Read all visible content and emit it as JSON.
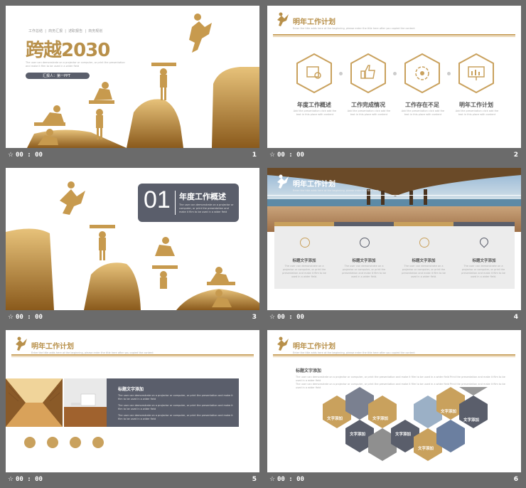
{
  "slides": [
    {
      "number": "1",
      "time": "00 : 00",
      "nav": [
        "工作总结",
        "商务汇报",
        "述职报告",
        "商务规划"
      ],
      "title": "跨越2030",
      "subtitle": "The user can demonstrate on a projector or computer, or print the presentation and make it film to be used in a wider field",
      "presenter": "汇报人：第一PPT"
    },
    {
      "number": "2",
      "time": "00 : 00",
      "header": "明年工作计划",
      "header_sub": "Enter the title adds here at the beginning, please enter the title here after you copied the content",
      "items": [
        {
          "label": "年度工作概述",
          "icon": "document-search-icon"
        },
        {
          "label": "工作完成情况",
          "icon": "thumbs-up-icon"
        },
        {
          "label": "工作存在不足",
          "icon": "gear-refresh-icon"
        },
        {
          "label": "明年工作计划",
          "icon": "monitor-chart-icon"
        }
      ],
      "item_desc": "Add the presentation click add the text in this place with content"
    },
    {
      "number": "3",
      "time": "00 : 00",
      "section_num": "01",
      "section_title": "年度工作概述",
      "section_desc": "The user can demonstrate on a projector or computer, or print the presentation and make it film to be used in a wider field"
    },
    {
      "number": "4",
      "time": "00 : 00",
      "header": "明年工作计划",
      "header_sub": "Enter the title adds here at the beginning, please enter the title here",
      "cards": [
        {
          "title": "标题文字添加",
          "icon": "rmb-icon"
        },
        {
          "title": "标题文字添加",
          "icon": "globe-icon"
        },
        {
          "title": "标题文字添加",
          "icon": "tag-icon"
        },
        {
          "title": "标题文字添加",
          "icon": "location-pin-icon"
        }
      ],
      "card_desc": "The user can demonstrate on a projector or computer, or print the presentation and make it film to be used in a wider field."
    },
    {
      "number": "5",
      "time": "00 : 00",
      "header": "明年工作计划",
      "header_sub": "Enter the title adds here at the beginning, please enter the title here after you copied the content",
      "panel_title": "标题文字添加",
      "panel_lines": [
        "The user can demonstrate on a projector or computer, or print the presentation and make it film to be used in a wider field",
        "The user can demonstrate on a projector or computer, or print the presentation and make it film to be used in a wider field",
        "The user can demonstrate on a projector or computer, or print the presentation and make it film to be used in a wider field"
      ],
      "icons": [
        "rmb-icon",
        "trophy-icon",
        "car-icon",
        "location-pin-icon"
      ]
    },
    {
      "number": "6",
      "time": "00 : 00",
      "header": "明年工作计划",
      "header_sub": "Enter the title adds here at the beginning, please enter the title here after you copied the content",
      "block_title": "标题文字添加",
      "block_lines": [
        "The user can demonstrate on a projector or computer, or print the presentation and make it film to be used in a wider field Print the presentation and make it film to be used in a wider field",
        "The user can demonstrate on a projector or computer, or print the presentation and make it film to be used in a wider field Print the presentation and make it film to be used in a wider field"
      ],
      "hex_label": "文字添加"
    }
  ],
  "colors": {
    "gold": "#c9a15d",
    "dark": "#5a5e6b",
    "bg": "#6b6b6b"
  }
}
